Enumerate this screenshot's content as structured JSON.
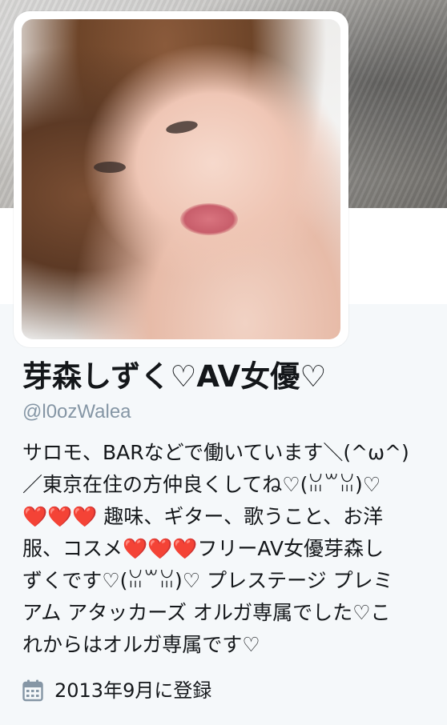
{
  "header": {
    "banner_label": "header-photo"
  },
  "avatar": {
    "icon": "profile-photo"
  },
  "profile": {
    "display_name": "芽森しずく♡AV女優♡",
    "screen_name": "@l0ozWalea",
    "bio_lines": [
      "サロモ、BARなどで働いています＼(^ω^)",
      "／東京在住の方仲良くしてね♡(ꈍ꒳ꈍ)♡",
      "❤️❤️❤️ 趣味、ギター、歌うこと、お洋",
      "服、コスメ❤️❤️❤️フリーAV女優芽森し",
      "ずくです♡(ꈍ꒳ꈍ)♡ プレステージ プレミ",
      "アム アタッカーズ オルガ専属でした♡こ",
      "れからはオルガ専属です♡"
    ],
    "joined_text": "2013年9月に登録",
    "joined_icon": "calendar-icon"
  },
  "colors": {
    "text_primary": "#14171a",
    "text_secondary": "#8596a5",
    "heart": "#e0245e",
    "background": "#f5f8fa"
  }
}
